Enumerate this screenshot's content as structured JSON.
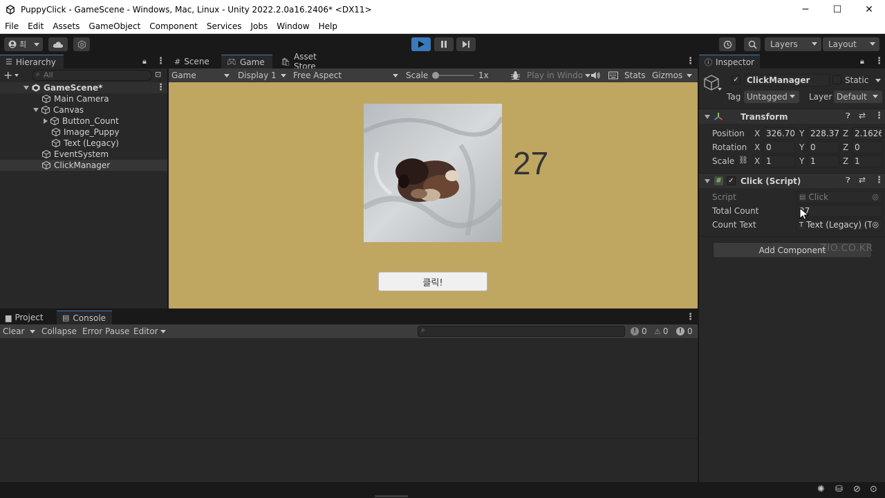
{
  "window": {
    "title": "PuppyClick - GameScene - Windows, Mac, Linux - Unity 2022.2.0a16.2406* <DX11>",
    "minimize": "─",
    "maximize": "☐",
    "close": "✕"
  },
  "menu": [
    "File",
    "Edit",
    "Assets",
    "GameObject",
    "Component",
    "Services",
    "Jobs",
    "Window",
    "Help"
  ],
  "toolbar": {
    "account_label": "최",
    "layers": "Layers",
    "layout": "Layout"
  },
  "hierarchy": {
    "tab": "Hierarchy",
    "search_placeholder": "All",
    "add": "+",
    "items": [
      {
        "label": "GameScene*"
      },
      {
        "label": "Main Camera"
      },
      {
        "label": "Canvas"
      },
      {
        "label": "Button_Count"
      },
      {
        "label": "Image_Puppy"
      },
      {
        "label": "Text (Legacy)"
      },
      {
        "label": "EventSystem"
      },
      {
        "label": "ClickManager"
      }
    ]
  },
  "center_tabs": {
    "scene": "Scene",
    "game": "Game",
    "asset_store": "Asset Store"
  },
  "game_toolbar": {
    "mode": "Game",
    "display": "Display 1",
    "aspect": "Free Aspect",
    "scale_label": "Scale",
    "scale_value": "1x",
    "play_in_window": "Play in Windo",
    "stats": "Stats",
    "gizmos": "Gizmos"
  },
  "game": {
    "count": "27",
    "button_label": "클릭!",
    "bg_color": "#bfa762"
  },
  "inspector": {
    "tab": "Inspector",
    "object_name": "ClickManager",
    "static_label": "Static",
    "tag_label": "Tag",
    "tag_value": "Untagged",
    "layer_label": "Layer",
    "layer_value": "Default",
    "transform": {
      "title": "Transform",
      "position_label": "Position",
      "rotation_label": "Rotation",
      "scale_label": "Scale",
      "position": {
        "x": "326.70",
        "y": "228.37",
        "z": "2.1626:"
      },
      "rotation": {
        "x": "0",
        "y": "0",
        "z": "0"
      },
      "scale": {
        "x": "1",
        "y": "1",
        "z": "1"
      },
      "axis_x": "X",
      "axis_y": "Y",
      "axis_z": "Z"
    },
    "click_script": {
      "title": "Click (Script)",
      "script_label": "Script",
      "script_value": "Click",
      "total_count_label": "Total Count",
      "total_count_value": "27",
      "count_text_label": "Count Text",
      "count_text_value": "Text (Legacy) (T"
    },
    "add_component": "Add Component",
    "watermark": "ZIO.CO.KR"
  },
  "bottom_tabs": {
    "project": "Project",
    "console": "Console"
  },
  "console": {
    "clear": "Clear",
    "collapse": "Collapse",
    "error_pause": "Error Pause",
    "editor": "Editor",
    "info_count": "0",
    "warning_count": "0",
    "error_count": "0"
  },
  "colors": {
    "accent": "#3a79bb",
    "play_active": "#3a79bb",
    "game_bg": "#bfa762"
  }
}
